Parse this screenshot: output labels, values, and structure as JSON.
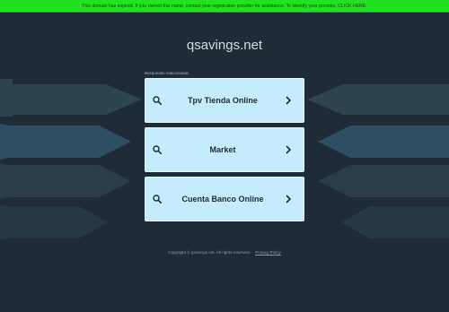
{
  "banner": {
    "text": "This domain has expired. If you owned this name, contact your registration provider for assistance. To identify your provider, CLICK HERE."
  },
  "site": {
    "domain": "qsavings.net"
  },
  "related": {
    "label": "Búsquedas relacionadas",
    "items": [
      {
        "label": "Tpv Tienda Online",
        "icon": "search-icon",
        "arrow": "chevron-right-icon"
      },
      {
        "label": "Market",
        "icon": "search-icon",
        "arrow": "chevron-right-icon"
      },
      {
        "label": "Cuenta Banco Online",
        "icon": "search-icon",
        "arrow": "chevron-right-icon"
      }
    ]
  },
  "footer": {
    "copyright": "Copyright © qsavings.net.  All rights reserved.",
    "privacy_label": "Privacy Policy"
  },
  "colors": {
    "background": "#1f2b36",
    "banner": "#22e11f",
    "card": "#c4ecfc",
    "deco_dark": "#2f4a52",
    "deco_blue": "#2d4e63"
  }
}
